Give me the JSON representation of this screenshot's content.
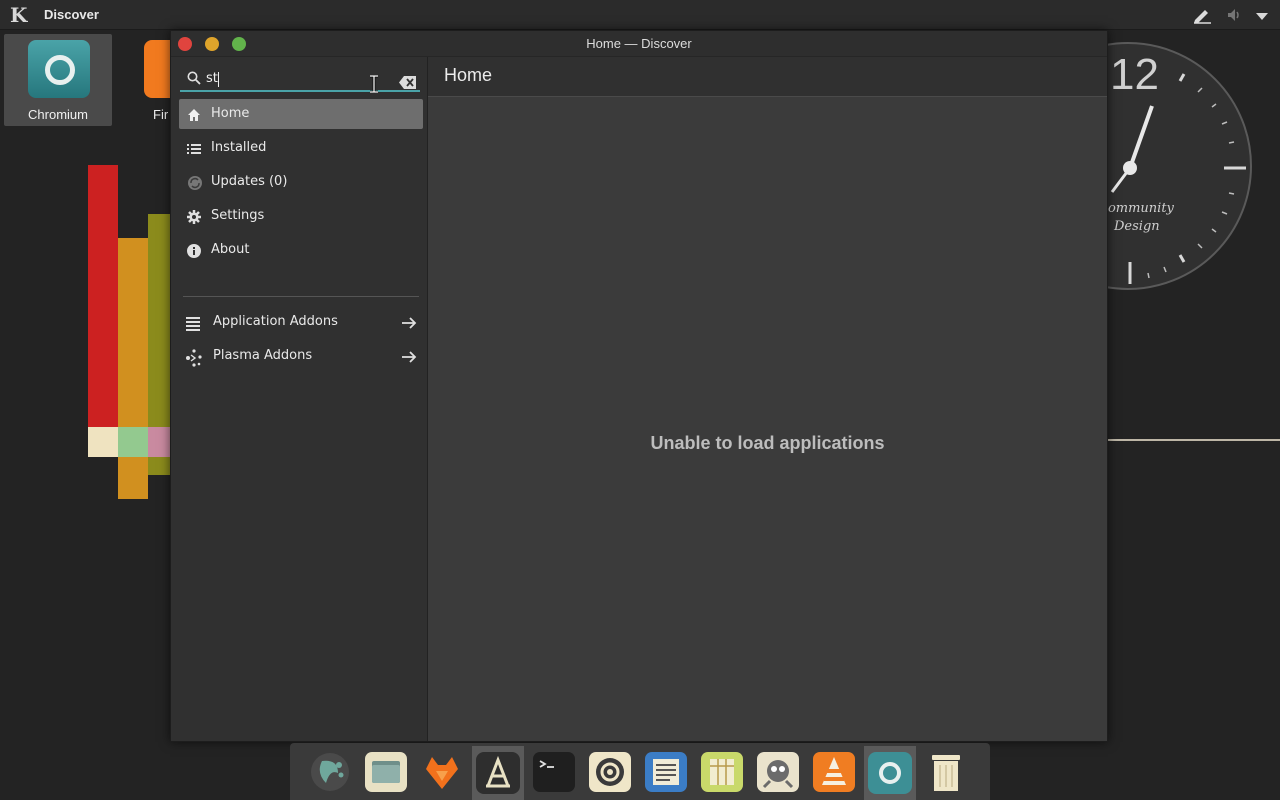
{
  "panel": {
    "app_name": "Discover"
  },
  "desktop": {
    "icons": [
      {
        "label": "Chromium"
      },
      {
        "label": "Fir"
      }
    ],
    "clock": {
      "numeral": "12",
      "brand_line1": "Community",
      "brand_line2": "Design"
    }
  },
  "window": {
    "title": "Home — Discover",
    "search": {
      "value": "st",
      "placeholder": ""
    },
    "nav": [
      {
        "label": "Home",
        "icon": "home-icon",
        "active": true
      },
      {
        "label": "Installed",
        "icon": "list-icon",
        "active": false
      },
      {
        "label": "Updates (0)",
        "icon": "updates-icon",
        "active": false
      },
      {
        "label": "Settings",
        "icon": "gear-icon",
        "active": false
      },
      {
        "label": "About",
        "icon": "info-icon",
        "active": false
      }
    ],
    "addons": [
      {
        "label": "Application Addons",
        "icon": "addons-list-icon"
      },
      {
        "label": "Plasma Addons",
        "icon": "plasma-icon"
      }
    ],
    "content": {
      "title": "Home",
      "message": "Unable to load applications"
    }
  },
  "dock": {
    "items": [
      {
        "name": "spectacle-icon",
        "color": "#3f5f5a"
      },
      {
        "name": "file-manager-icon",
        "color": "#e8e1c4"
      },
      {
        "name": "firefox-icon",
        "color": "#f2711c"
      },
      {
        "name": "discover-icon",
        "color": "#2e2e2e"
      },
      {
        "name": "terminal-icon",
        "color": "#1f1f1f"
      },
      {
        "name": "system-settings-icon",
        "color": "#efe6c8"
      },
      {
        "name": "news-reader-icon",
        "color": "#3b7dc6"
      },
      {
        "name": "spreadsheet-icon",
        "color": "#c9d96a"
      },
      {
        "name": "gimp-icon",
        "color": "#eae3cc"
      },
      {
        "name": "vlc-icon",
        "color": "#f07d22"
      },
      {
        "name": "chromium-icon",
        "color": "#3d8f95"
      },
      {
        "name": "trash-icon",
        "color": "#efe6c8"
      }
    ]
  },
  "colors": {
    "accent": "#4aa3a8",
    "bar_red": "#cc2121",
    "bar_orange": "#d1901f",
    "bar_olive": "#8b8b1c"
  }
}
